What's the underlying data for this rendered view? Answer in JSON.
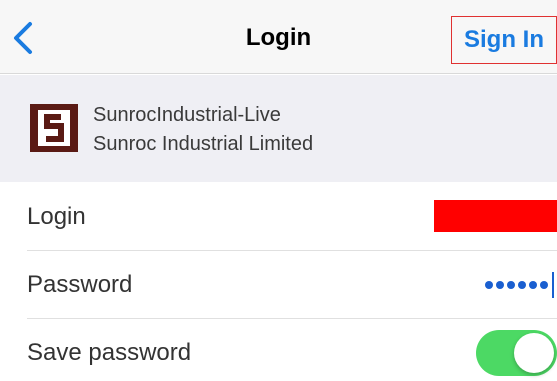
{
  "nav": {
    "title": "Login",
    "sign_in_label": "Sign In",
    "back_icon": "chevron-left-icon"
  },
  "company": {
    "logo_letter": "S",
    "database_name": "SunrocIndustrial-Live",
    "company_name": "Sunroc Industrial Limited"
  },
  "form": {
    "login_label": "Login",
    "login_value": "",
    "password_label": "Password",
    "password_length": 6,
    "save_password_label": "Save password",
    "save_password_on": true
  },
  "colors": {
    "accent": "#1a7be0",
    "toggle_on": "#4cd964",
    "redaction": "#ff0000",
    "logo_bg": "#5a1a14"
  }
}
